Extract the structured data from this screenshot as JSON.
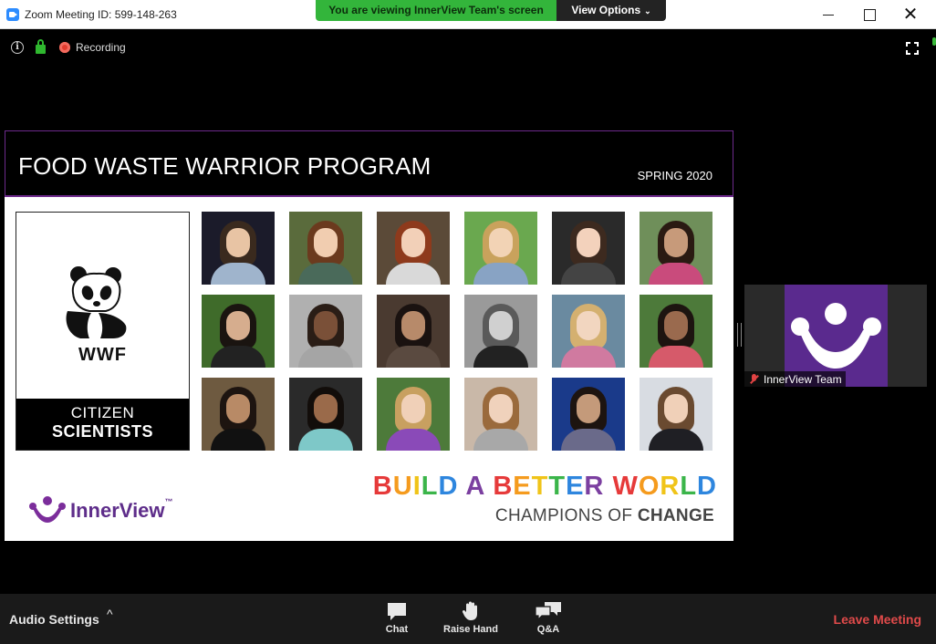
{
  "window": {
    "title": "Zoom Meeting ID: 599-148-263",
    "share_banner": "You are viewing InnerView Team's screen",
    "view_options": "View Options",
    "close_glyph": "✕"
  },
  "status": {
    "recording": "Recording",
    "info_glyph": "i"
  },
  "slide": {
    "title": "FOOD WASTE WARRIOR PROGRAM",
    "season": "SPRING 2020",
    "wwf_logo": "WWF",
    "citizen": "CITIZEN",
    "scientists": "SCIENTISTS",
    "innerview_brand": "InnerView",
    "trademark": "™",
    "build_words": [
      "BUILD",
      "A",
      "BETTER",
      "WORLD"
    ],
    "champions_prefix": "CHAMPIONS OF",
    "champions_suffix": "CHANGE"
  },
  "participant": {
    "name": "InnerView Team"
  },
  "toolbar": {
    "audio_settings": "Audio Settings",
    "audio_caret": "^",
    "chat": "Chat",
    "raise_hand": "Raise Hand",
    "qa": "Q&A",
    "leave": "Leave Meeting"
  },
  "colors": {
    "share_green": "#33b53b",
    "leave_red": "#e04a4a",
    "innerview_purple": "#5a2a8e",
    "build_letters": [
      "#e63a3a",
      "#f59b1e",
      "#f0c419",
      "#3bb54a",
      "#2e86de",
      "#7b3fa0"
    ]
  },
  "icons": [
    "zoom-logo-icon",
    "info-icon",
    "lock-icon",
    "record-icon",
    "fullscreen-icon",
    "panda-icon",
    "mic-muted-icon",
    "chat-icon",
    "raise-hand-icon",
    "qa-icon"
  ]
}
